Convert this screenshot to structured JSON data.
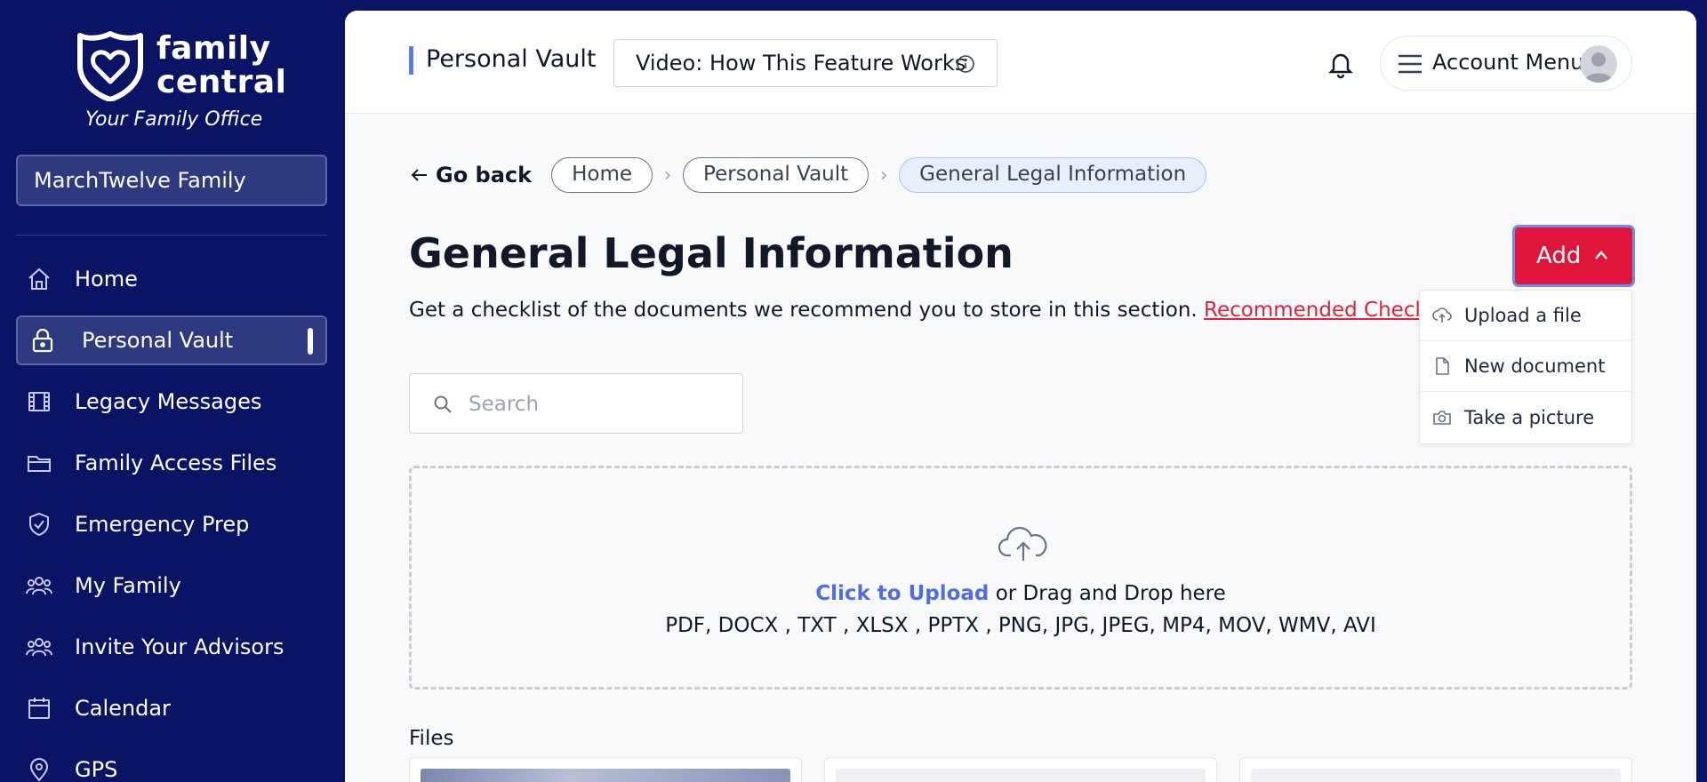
{
  "sidebar": {
    "logo_line1": "family",
    "logo_line2": "central",
    "tagline": "Your Family Office",
    "family_select": "MarchTwelve Family",
    "items": [
      {
        "label": "Home",
        "icon": "home-icon"
      },
      {
        "label": "Personal Vault",
        "icon": "lock-icon",
        "active": true
      },
      {
        "label": "Legacy Messages",
        "icon": "film-icon"
      },
      {
        "label": "Family Access Files",
        "icon": "folder-icon"
      },
      {
        "label": "Emergency Prep",
        "icon": "shield-check-icon"
      },
      {
        "label": "My Family",
        "icon": "users-icon"
      },
      {
        "label": "Invite Your Advisors",
        "icon": "users-icon"
      },
      {
        "label": "Calendar",
        "icon": "calendar-icon"
      },
      {
        "label": "GPS",
        "icon": "location-pin-icon"
      }
    ]
  },
  "header": {
    "title": "Personal Vault",
    "video_button": "Video: How This Feature Works",
    "account_menu": "Account Menu"
  },
  "breadcrumb": {
    "go_back": "Go back",
    "items": [
      "Home",
      "Personal Vault",
      "General Legal Information"
    ]
  },
  "page": {
    "title": "General Legal Information",
    "subtext": "Get a checklist of the documents we recommend you to store in this section.",
    "checklist_link": "Recommended Checklist."
  },
  "add_menu": {
    "button": "Add",
    "items": [
      "Upload a file",
      "New document",
      "Take a picture"
    ]
  },
  "search": {
    "placeholder": "Search",
    "value": ""
  },
  "dropzone": {
    "click_label": "Click to Upload",
    "drag_label": " or Drag and Drop here",
    "formats": "PDF, DOCX , TXT , XLSX , PPTX , PNG, JPG, JPEG, MP4, MOV, WMV, AVI"
  },
  "files": {
    "label": "Files"
  },
  "colors": {
    "sidebar_bg": "#0a1464",
    "accent_red": "#e0153c",
    "link_blue": "#4f6fe0",
    "active_item_bg": "#2d3a80"
  }
}
